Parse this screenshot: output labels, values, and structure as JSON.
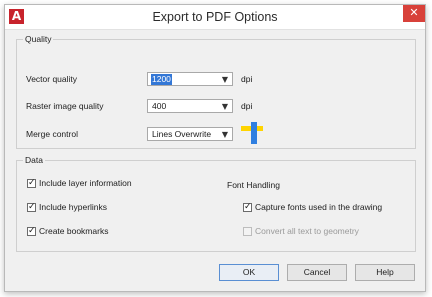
{
  "window": {
    "title": "Export to PDF Options",
    "close_glyph": "✕",
    "app_icon_text": "A"
  },
  "quality": {
    "label": "Quality",
    "vector": {
      "label": "Vector quality",
      "value": "1200",
      "unit": "dpi"
    },
    "raster": {
      "label": "Raster image quality",
      "value": "400",
      "unit": "dpi"
    },
    "merge": {
      "label": "Merge control",
      "value": "Lines Overwrite",
      "icon": "merge-control-preview-icon"
    }
  },
  "data": {
    "label": "Data",
    "include_layer": {
      "label": "Include layer information",
      "checked": true
    },
    "include_hyperlinks": {
      "label": "Include hyperlinks",
      "checked": true
    },
    "create_bookmarks": {
      "label": "Create bookmarks",
      "checked": true
    },
    "font_handling": {
      "label": "Font Handling",
      "capture_fonts": {
        "label": "Capture fonts used in the drawing",
        "checked": true
      },
      "convert_text": {
        "label": "Convert all text to geometry",
        "checked": false,
        "disabled": true
      }
    }
  },
  "buttons": {
    "ok": "OK",
    "cancel": "Cancel",
    "help": "Help"
  },
  "icons": {
    "dropdown": "chevron-down-icon",
    "check": "check-icon"
  },
  "colors": {
    "close": "#d8413a",
    "app_icon": "#c8232c",
    "selection": "#3377d6"
  }
}
